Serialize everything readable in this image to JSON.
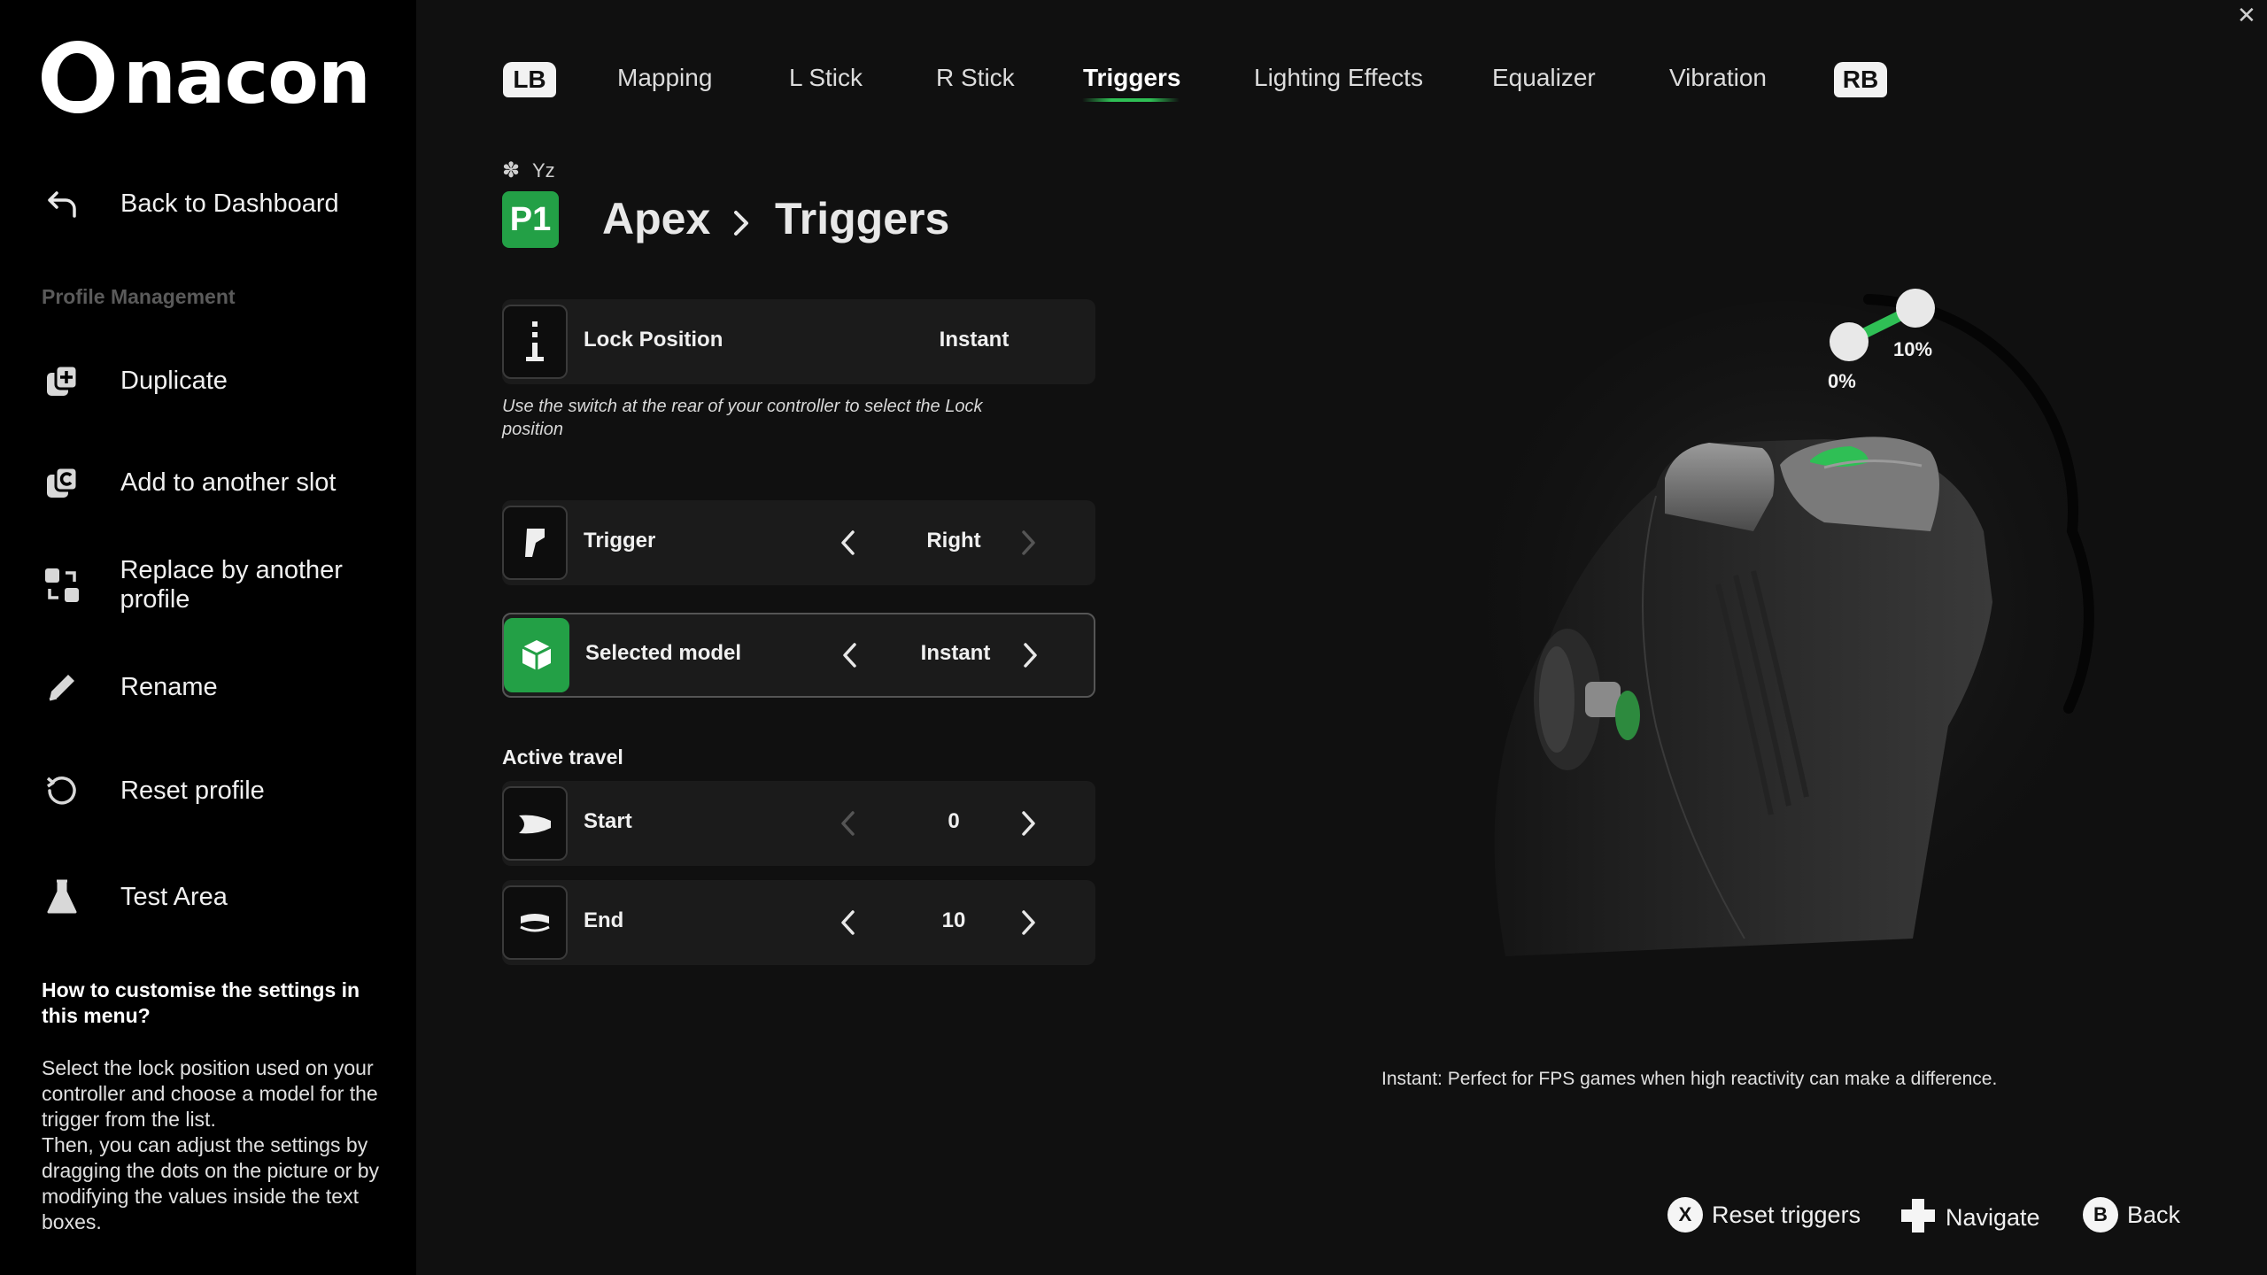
{
  "brand": {
    "name": "nacon"
  },
  "sidebar": {
    "back": "Back to Dashboard",
    "section_label": "Profile Management",
    "items": [
      {
        "label": "Duplicate",
        "icon": "duplicate-icon"
      },
      {
        "label": "Add to another slot",
        "icon": "add-slot-icon"
      },
      {
        "label": "Replace by another profile",
        "icon": "replace-icon"
      },
      {
        "label": "Rename",
        "icon": "pencil-icon"
      },
      {
        "label": "Reset profile",
        "icon": "reset-icon"
      },
      {
        "label": "Test Area",
        "icon": "flask-icon"
      }
    ],
    "help_title": "How to customise the settings in this menu?",
    "help_body": "Select the lock position used on your controller and choose a model for the trigger from the list.\nThen, you can adjust the settings by dragging the dots on the picture or by modifying the values inside the text boxes."
  },
  "nav": {
    "lb": "LB",
    "rb": "RB",
    "tabs": [
      "Mapping",
      "L Stick",
      "R Stick",
      "Triggers",
      "Lighting Effects",
      "Equalizer",
      "Vibration"
    ],
    "active_tab": "Triggers"
  },
  "header": {
    "slot_letters": "Yz",
    "slot_badge": "P1",
    "profile": "Apex",
    "page": "Triggers"
  },
  "settings": {
    "lock": {
      "label": "Lock Position",
      "value": "Instant"
    },
    "note": "Use the switch at the rear of your controller to select the Lock position",
    "trigger": {
      "label": "Trigger",
      "value": "Right"
    },
    "model": {
      "label": "Selected model",
      "value": "Instant"
    },
    "active_travel": "Active travel",
    "start": {
      "label": "Start",
      "value": "0"
    },
    "end": {
      "label": "End",
      "value": "10"
    }
  },
  "visual": {
    "start_label": "0%",
    "end_label": "10%",
    "description": "Instant: Perfect for FPS games when high reactivity can make a difference."
  },
  "hints": {
    "reset": {
      "button": "X",
      "label": "Reset triggers"
    },
    "navigate": {
      "label": "Navigate"
    },
    "back": {
      "button": "B",
      "label": "Back"
    }
  },
  "colors": {
    "accent": "#23a046",
    "background": "#101010",
    "sidebar": "#000000"
  }
}
